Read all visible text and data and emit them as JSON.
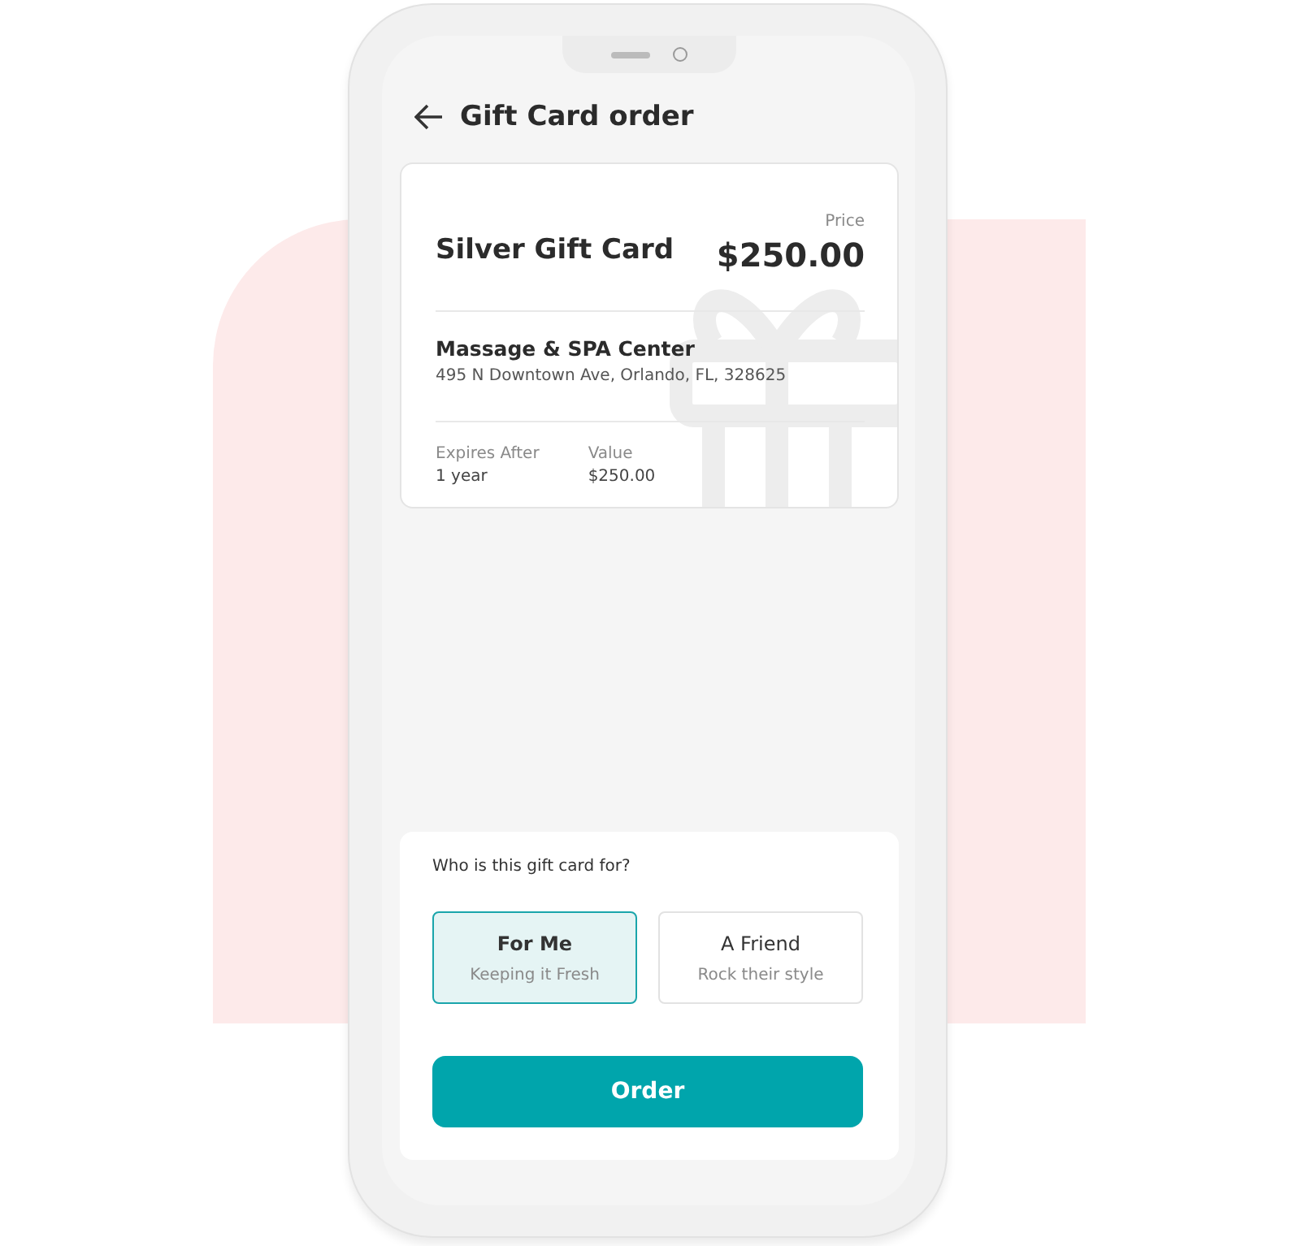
{
  "header": {
    "title": "Gift Card order"
  },
  "card": {
    "price_label": "Price",
    "name": "Silver Gift Card",
    "price": "$250.00",
    "merchant": "Massage & SPA Center",
    "address": "495 N Downtown Ave, Orlando, FL, 328625",
    "details": [
      {
        "label": "Expires After",
        "value": "1 year"
      },
      {
        "label": "Value",
        "value": "$250.00"
      }
    ]
  },
  "recipient": {
    "question": "Who is this gift card for?",
    "options": [
      {
        "title": "For Me",
        "subtitle": "Keeping it Fresh",
        "selected": true
      },
      {
        "title": "A Friend",
        "subtitle": "Rock their style",
        "selected": false
      }
    ]
  },
  "order_button": "Order"
}
